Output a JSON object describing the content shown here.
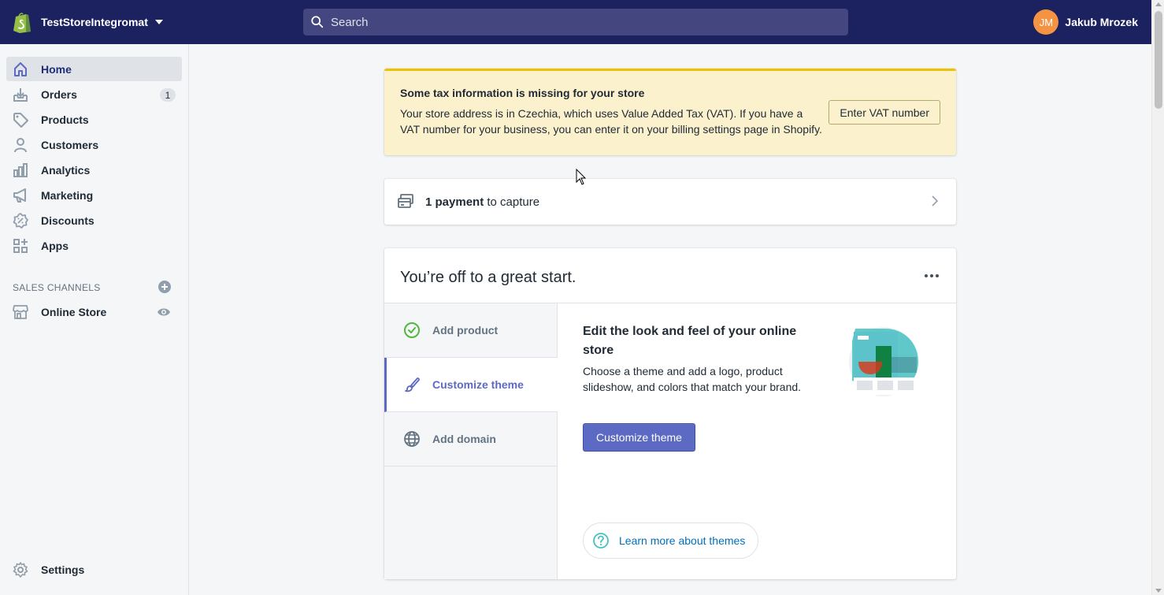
{
  "topbar": {
    "store_name": "TestStoreIntegromat",
    "search_placeholder": "Search",
    "user_initials": "JM",
    "user_name": "Jakub Mrozek"
  },
  "sidebar": {
    "items": [
      {
        "label": "Home",
        "icon": "home-icon",
        "active": true
      },
      {
        "label": "Orders",
        "icon": "orders-icon",
        "badge": "1"
      },
      {
        "label": "Products",
        "icon": "tag-icon"
      },
      {
        "label": "Customers",
        "icon": "person-icon"
      },
      {
        "label": "Analytics",
        "icon": "bar-chart-icon"
      },
      {
        "label": "Marketing",
        "icon": "megaphone-icon"
      },
      {
        "label": "Discounts",
        "icon": "discount-icon"
      },
      {
        "label": "Apps",
        "icon": "apps-icon"
      }
    ],
    "channels_heading": "SALES CHANNELS",
    "online_store": "Online Store",
    "settings": "Settings"
  },
  "banner": {
    "title": "Some tax information is missing for your store",
    "body": "Your store address is in Czechia, which uses Value Added Tax (VAT). If you have a VAT number for your business, you can enter it on your billing settings page in Shopify.",
    "button": "Enter VAT number"
  },
  "payment": {
    "count": "1 payment",
    "suffix": " to capture"
  },
  "start": {
    "title": "You’re off to a great start.",
    "steps": [
      {
        "label": "Add product",
        "icon": "check-circle-icon",
        "state": "done"
      },
      {
        "label": "Customize theme",
        "icon": "brush-icon",
        "state": "active"
      },
      {
        "label": "Add domain",
        "icon": "globe-icon",
        "state": "todo"
      }
    ],
    "detail_title": "Edit the look and feel of your online store",
    "detail_body": "Choose a theme and add a logo, product slideshow, and colors that match your brand.",
    "detail_button": "Customize theme",
    "learn_more": "Learn more about themes"
  },
  "colors": {
    "topbar": "#1c2260",
    "accent": "#5c6ac4",
    "banner_bg": "#fcf1cd",
    "banner_border": "#eec200",
    "link": "#006fbb"
  }
}
